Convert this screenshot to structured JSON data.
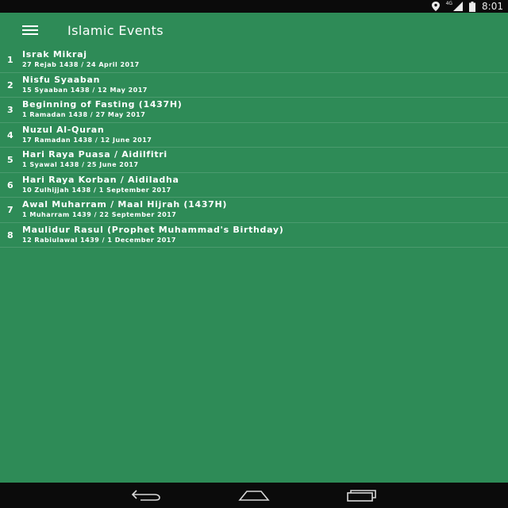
{
  "status_bar": {
    "time": "8:01",
    "network": "4G",
    "icons": [
      "location-icon",
      "signal-icon",
      "battery-icon"
    ]
  },
  "app_bar": {
    "title": "Islamic Events",
    "menu_icon": "hamburger-menu-icon"
  },
  "events": [
    {
      "number": "1",
      "name": "Israk Mikraj",
      "date": "27 Rejab 1438 / 24 April 2017"
    },
    {
      "number": "2",
      "name": "Nisfu Syaaban",
      "date": "15 Syaaban 1438 / 12 May 2017"
    },
    {
      "number": "3",
      "name": "Beginning of Fasting  (1437H)",
      "date": "1 Ramadan 1438 / 27 May 2017"
    },
    {
      "number": "4",
      "name": "Nuzul Al-Quran",
      "date": "17 Ramadan 1438 / 12 June 2017"
    },
    {
      "number": "5",
      "name": "Hari Raya Puasa / Aidilfitri",
      "date": "1 Syawal 1438 / 25 June 2017"
    },
    {
      "number": "6",
      "name": "Hari Raya Korban / Aidiladha",
      "date": "10 Zulhijjah 1438 / 1 September 2017"
    },
    {
      "number": "7",
      "name": "Awal Muharram / Maal Hijrah (1437H)",
      "date": "1 Muharram 1439 / 22 September 2017"
    },
    {
      "number": "8",
      "name": "Maulidur Rasul (Prophet Muhammad's Birthday)",
      "date": "12 Rabiulawal 1439 / 1 December 2017"
    }
  ],
  "nav_bar": {
    "buttons": [
      "back-icon",
      "home-icon",
      "recents-icon"
    ]
  },
  "colors": {
    "background": "#2e8b57",
    "system_bars": "#0b0b0b",
    "text": "#ffffff"
  }
}
